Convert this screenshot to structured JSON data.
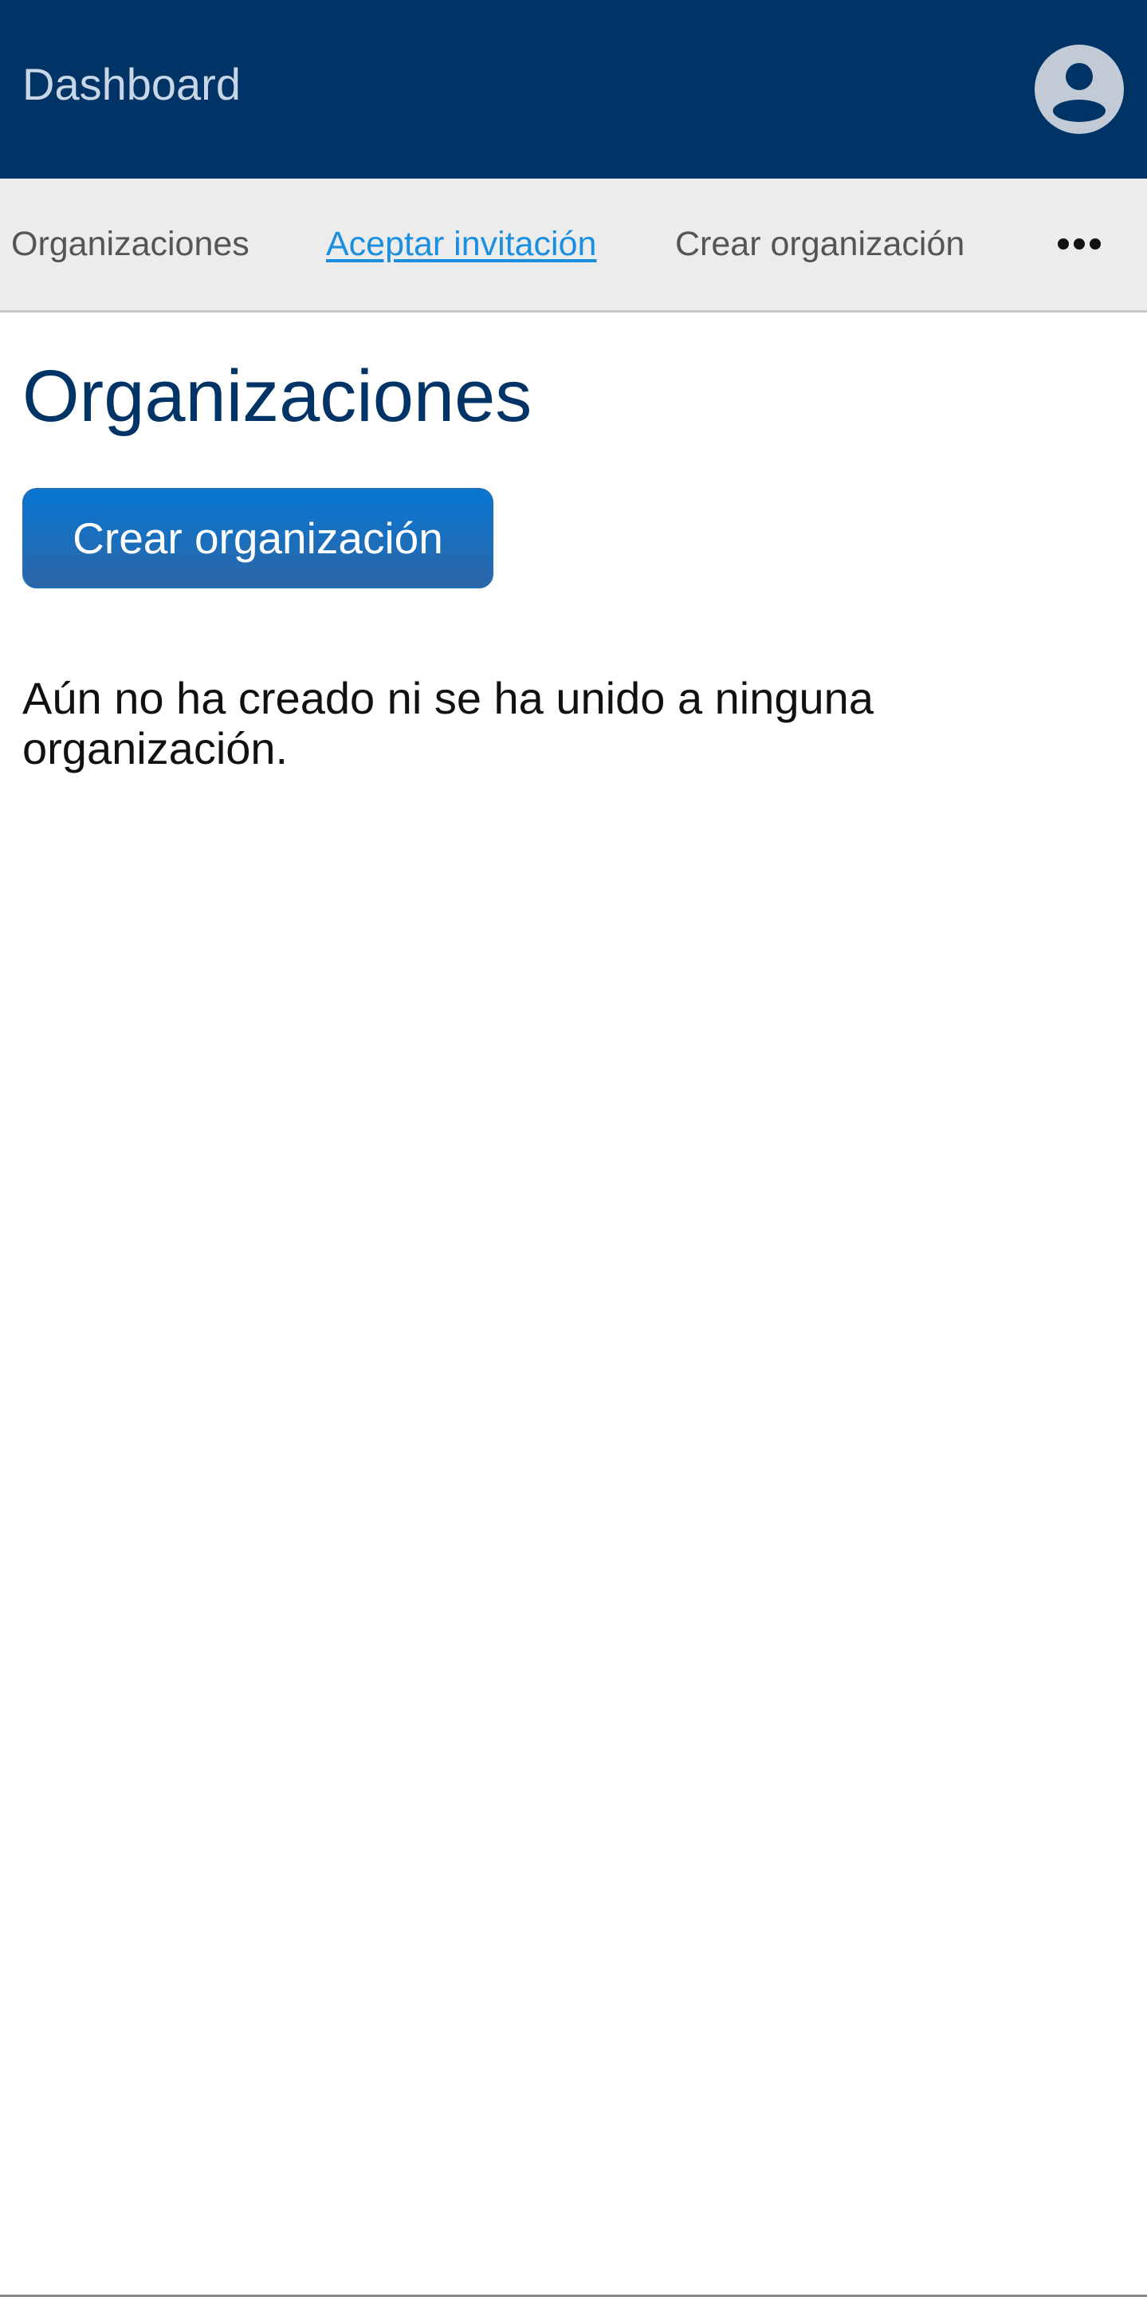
{
  "header": {
    "title": "Dashboard",
    "account_icon": "user-circle-icon"
  },
  "nav": {
    "items": [
      {
        "label": "Organizaciones",
        "active": false
      },
      {
        "label": "Aceptar invitación",
        "active": true
      },
      {
        "label": "Crear organización",
        "active": false
      }
    ],
    "more_icon": "ellipsis-icon"
  },
  "main": {
    "title": "Organizaciones",
    "create_button_label": "Crear organización",
    "empty_message": "Aún no ha creado ni se ha unido a ninguna organización."
  },
  "colors": {
    "header_bg": "#003366",
    "nav_bg": "#ececec",
    "active_link": "#1a8fe0",
    "button_bg": "#0877d2",
    "title_text": "#003366"
  }
}
